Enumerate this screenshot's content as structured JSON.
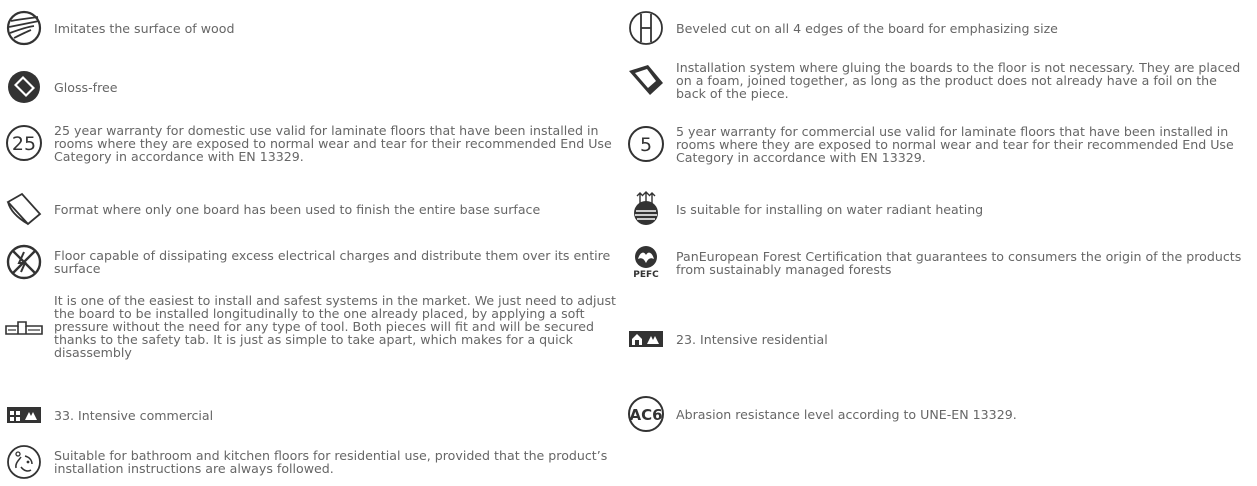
{
  "colors": {
    "text": "#666666",
    "icon": "#333333"
  },
  "left_features": [
    {
      "icon": "wood-grain-icon",
      "text": "Imitates the surface of wood"
    },
    {
      "icon": "gloss-free-icon",
      "text": "Gloss-free"
    },
    {
      "icon": "warranty-25-icon",
      "badge": "25",
      "text": "25 year warranty for domestic use valid for laminate floors that have been installed in rooms where they are exposed to normal wear and tear for their recommended End Use Category in accordance with EN 13329."
    },
    {
      "icon": "single-board-format-icon",
      "text": "Format where only one board has been used to finish the entire base surface"
    },
    {
      "icon": "antistatic-icon",
      "text": "Floor capable of dissipating excess electrical charges and distribute them over its entire surface"
    },
    {
      "icon": "click-system-icon",
      "text": "It is one of the easiest to install and safest systems in the market. We just need to adjust the board to be installed longitudinally to the one already placed, by applying a soft pressure without the need for any type of tool. Both pieces will fit and will be secured thanks to the safety tab. It is just as simple to take apart, which makes for a quick disassembly"
    },
    {
      "icon": "intensive-commercial-icon",
      "text": "33. Intensive commercial"
    },
    {
      "icon": "wet-area-icon",
      "text": "Suitable for bathroom and kitchen floors for residential use, provided that the product’s installation instructions are always followed."
    }
  ],
  "right_features": [
    {
      "icon": "beveled-edges-icon",
      "text": "Beveled cut on all 4 edges of the board for emphasizing size"
    },
    {
      "icon": "floating-install-icon",
      "text": "Installation system where gluing the boards to the floor is not necessary. They are placed on a foam, joined together, as long as the product does not already have a foil on the back of the piece."
    },
    {
      "icon": "warranty-5-icon",
      "badge": "5",
      "text": "5 year warranty for commercial use valid for laminate floors that have been installed in rooms where they are exposed to normal wear and tear for their recommended End Use Category in accordance with EN 13329."
    },
    {
      "icon": "radiant-heating-icon",
      "text": "Is suitable for installing on water radiant heating"
    },
    {
      "icon": "pefc-icon",
      "logo_text": "PEFC",
      "text": "PanEuropean Forest Certification that guarantees to consumers the origin of the products from sustainably managed forests"
    },
    {
      "icon": "intensive-residential-icon",
      "text": "23. Intensive residential"
    },
    {
      "icon": "abrasion-ac6-icon",
      "badge": "AC6",
      "text": "Abrasion resistance level according to UNE-EN 13329."
    }
  ]
}
